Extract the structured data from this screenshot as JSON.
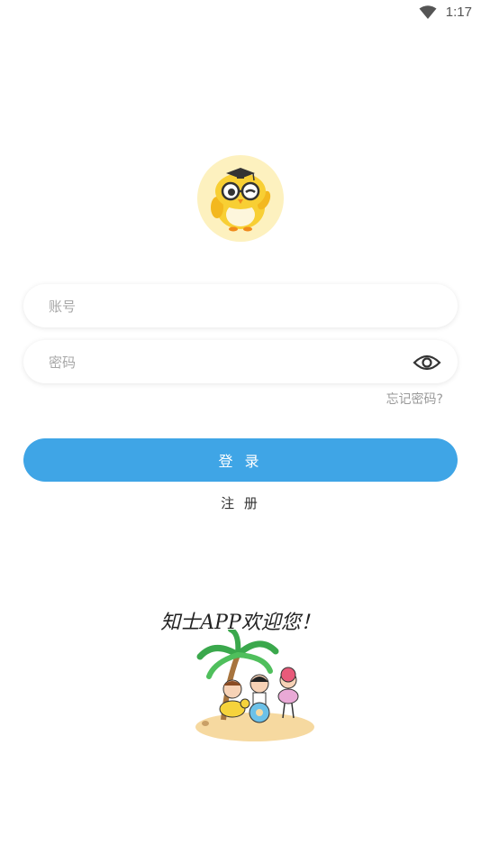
{
  "status_bar": {
    "time": "1:17",
    "icons": [
      "wifi-icon"
    ]
  },
  "logo": {
    "icon": "owl-scholar-logo"
  },
  "form": {
    "account_placeholder": "账号",
    "password_placeholder": "密码",
    "forgot_password": "忘记密码?",
    "login_label": "登 录",
    "register_label": "注 册"
  },
  "footer": {
    "welcome_text": "知士APP欢迎您！",
    "illustration": "beach-kids-palm-tree"
  },
  "colors": {
    "primary": "#3fa5e6",
    "logo_bg": "#fdf1bf"
  }
}
